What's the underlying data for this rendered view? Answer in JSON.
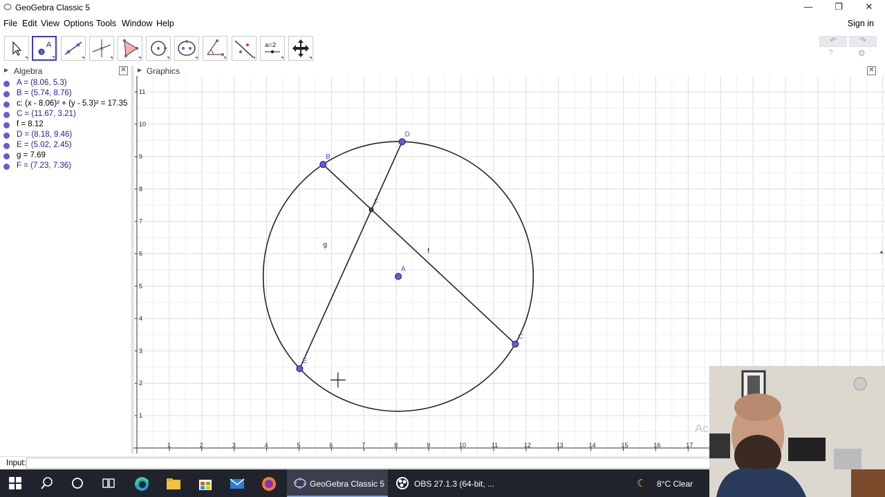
{
  "window": {
    "title": "GeoGebra Classic 5",
    "controls": {
      "minimize": "—",
      "restore": "❐",
      "close": "✕"
    }
  },
  "menu": {
    "items": [
      "File",
      "Edit",
      "View",
      "Options",
      "Tools",
      "Window",
      "Help"
    ],
    "signin": "Sign in"
  },
  "toolbar": {
    "tools": [
      "move-tool",
      "point-tool",
      "line-tool",
      "perpendicular-line-tool",
      "polygon-tool",
      "circle-tool",
      "conic-tool",
      "angle-tool",
      "reflect-tool",
      "slider-tool",
      "move-graphics-view-tool"
    ],
    "slider_label": "a=2",
    "undo": "↶",
    "redo": "↷",
    "help": "?",
    "settings": "⚙"
  },
  "algebra": {
    "title": "Algebra",
    "items": [
      {
        "text": "A = (8.06, 5.3)",
        "kind": "pt"
      },
      {
        "text": "B = (5.74, 8.76)",
        "kind": "pt"
      },
      {
        "text": "c: (x - 8.06)² + (y - 5.3)² = 17.35",
        "kind": "obj"
      },
      {
        "text": "C = (11.67, 3.21)",
        "kind": "pt"
      },
      {
        "text": "f = 8.12",
        "kind": "obj"
      },
      {
        "text": "D = (8.18, 9.46)",
        "kind": "pt"
      },
      {
        "text": "E = (5.02, 2.45)",
        "kind": "pt"
      },
      {
        "text": "g = 7.69",
        "kind": "obj"
      },
      {
        "text": "F = (7.23, 7.36)",
        "kind": "pt"
      }
    ]
  },
  "graphics": {
    "title": "Graphics",
    "x_ticks": [
      "1",
      "2",
      "3",
      "4",
      "5",
      "6",
      "7",
      "8",
      "9",
      "10",
      "11",
      "12",
      "13",
      "14",
      "15",
      "16",
      "17"
    ],
    "y_ticks": [
      "1",
      "2",
      "3",
      "4",
      "5",
      "6",
      "7",
      "8",
      "9",
      "10",
      "11"
    ],
    "geometry": {
      "circle": {
        "center": [
          8.06,
          5.3
        ],
        "radius": 4.165
      },
      "points": [
        {
          "name": "A",
          "x": 8.06,
          "y": 5.3,
          "label": "A"
        },
        {
          "name": "B",
          "x": 5.74,
          "y": 8.76,
          "label": "B"
        },
        {
          "name": "C",
          "x": 11.67,
          "y": 3.21,
          "label": "C"
        },
        {
          "name": "D",
          "x": 8.18,
          "y": 9.46,
          "label": "D"
        },
        {
          "name": "E",
          "x": 5.02,
          "y": 2.45,
          "label": "E"
        },
        {
          "name": "F",
          "x": 7.23,
          "y": 7.36,
          "label": "F"
        }
      ],
      "segments": [
        {
          "name": "f",
          "from": "B",
          "to": "C"
        },
        {
          "name": "g",
          "from": "D",
          "to": "E"
        }
      ],
      "segment_labels": [
        "f",
        "g"
      ]
    },
    "watermark": "Ac"
  },
  "input": {
    "label": "Input:"
  },
  "taskbar": {
    "apps": [
      {
        "label": "GeoGebra Classic 5"
      },
      {
        "label": "OBS 27.1.3 (64-bit, ..."
      }
    ],
    "weather": "8°C  Clear"
  },
  "colors": {
    "point": "#6a5ad5",
    "point_stroke": "#1a1a8a",
    "grid": "#e2e2e2",
    "taskbar": "#20232b"
  }
}
